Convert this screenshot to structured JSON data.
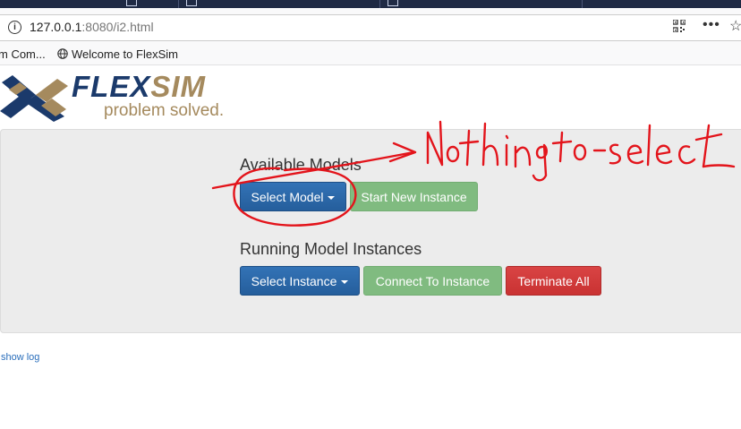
{
  "browser": {
    "url_host": "127.0.0.1",
    "url_rest": ":8080/i2.html",
    "bookmarks": [
      {
        "label": "m Com..."
      },
      {
        "label": "Welcome to FlexSim"
      }
    ]
  },
  "logo": {
    "name_a": "FLEX",
    "name_b": "SIM",
    "tagline": "problem solved."
  },
  "models": {
    "title": "Available Models",
    "select_label": "Select Model",
    "start_label": "Start New Instance"
  },
  "instances": {
    "title": "Running Model Instances",
    "select_label": "Select Instance",
    "connect_label": "Connect To Instance",
    "terminate_label": "Terminate All"
  },
  "footer": {
    "show_log": "show log"
  },
  "annotation": {
    "handwritten_note": "Nothing to select"
  },
  "colors": {
    "primary": "#2d68a8",
    "success": "#80bb80",
    "danger": "#d43b3b",
    "annotation": "#e3141b",
    "logo_blue": "#1b3a6b",
    "logo_gold": "#a58a5e"
  }
}
